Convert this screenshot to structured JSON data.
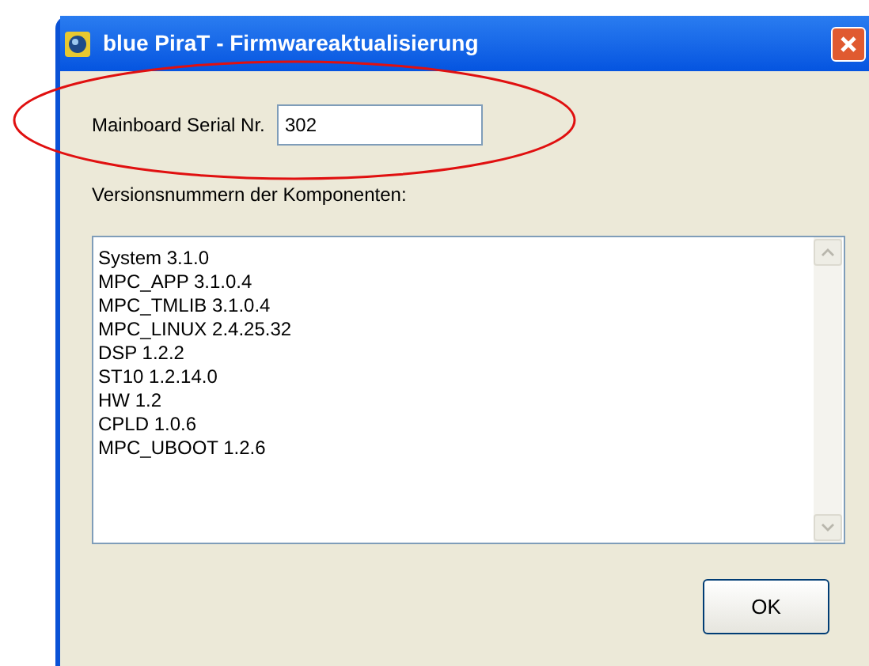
{
  "window": {
    "title": "blue PiraT - Firmwareaktualisierung"
  },
  "serial": {
    "label": "Mainboard Serial Nr.",
    "value": "302"
  },
  "versions": {
    "label": "Versionsnummern der Komponenten:",
    "lines": [
      "System 3.1.0",
      "MPC_APP 3.1.0.4",
      "MPC_TMLIB 3.1.0.4",
      "MPC_LINUX 2.4.25.32",
      "DSP 1.2.2",
      "ST10 1.2.14.0",
      "HW 1.2",
      "CPLD 1.0.6",
      "MPC_UBOOT 1.2.6"
    ]
  },
  "buttons": [
    "OK"
  ]
}
